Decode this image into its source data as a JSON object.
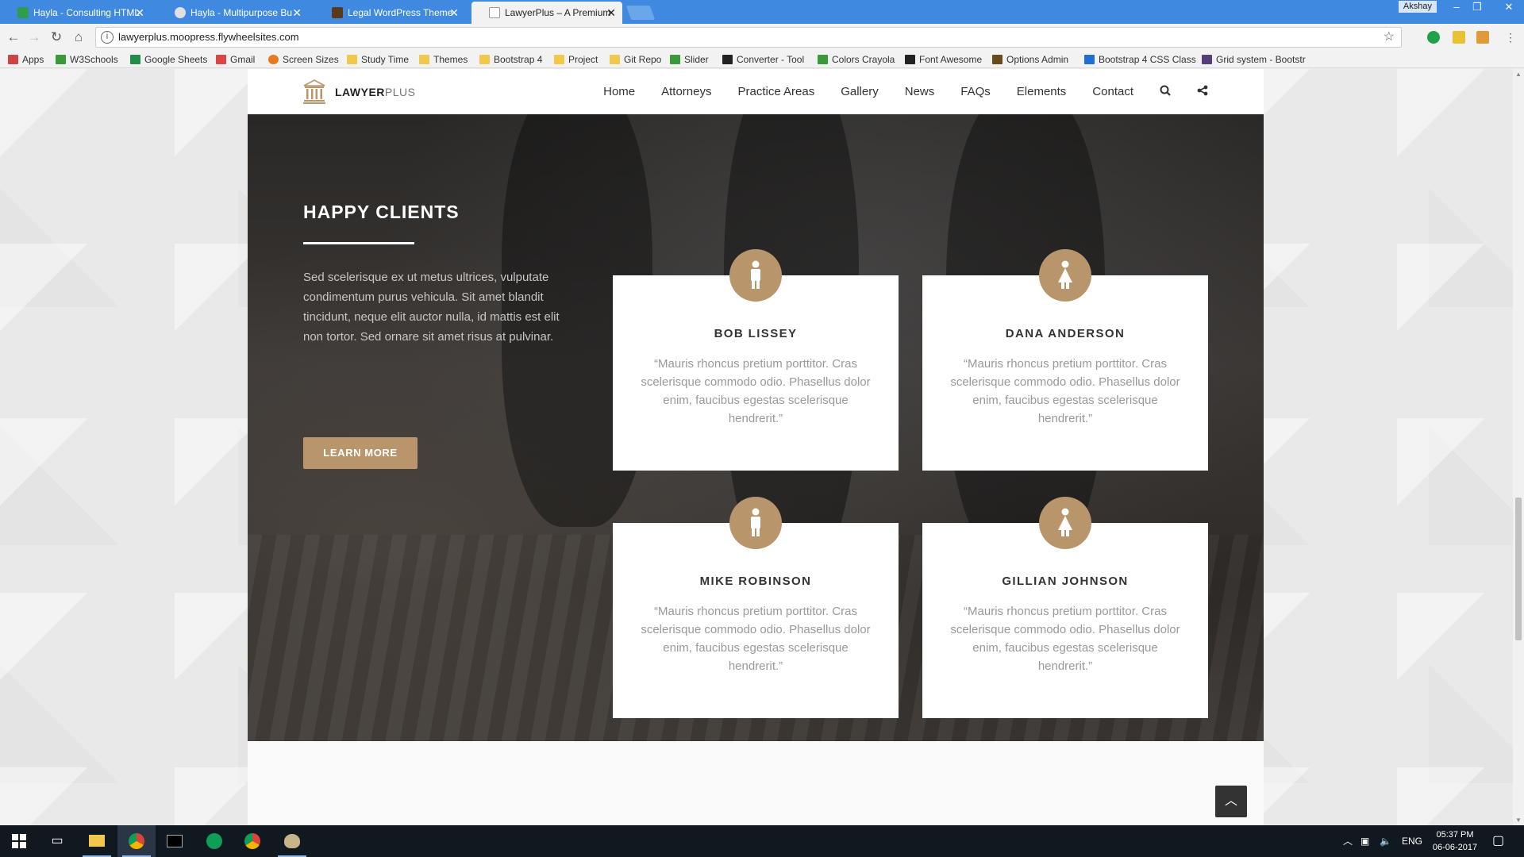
{
  "browser": {
    "tabs": [
      {
        "title": "Hayla - Consulting HTML",
        "favicon_color": "#2e9d4e"
      },
      {
        "title": "Hayla - Multipurpose Bu",
        "favicon_color": "#e0e0e0"
      },
      {
        "title": "Legal WordPress Theme",
        "favicon_color": "#5b3a1a"
      },
      {
        "title": "LawyerPlus – A Premium",
        "favicon_color": "#ffffff"
      }
    ],
    "active_tab": 3,
    "user": "Akshay",
    "url": "lawyerplus.moopress.flywheelsites.com",
    "bookmarks": [
      {
        "label": "Apps",
        "icon_color": "#c44"
      },
      {
        "label": "W3Schools",
        "icon_color": "#3a9a3a"
      },
      {
        "label": "Google Sheets",
        "icon_color": "#1f8f4a"
      },
      {
        "label": "Gmail",
        "icon_color": "#d44"
      },
      {
        "label": "Screen Sizes",
        "icon_color": "#e87a1e"
      },
      {
        "label": "Study Time",
        "icon_color": "#f1c84b"
      },
      {
        "label": "Themes",
        "icon_color": "#f1c84b"
      },
      {
        "label": "Bootstrap 4",
        "icon_color": "#f1c84b"
      },
      {
        "label": "Project",
        "icon_color": "#f1c84b"
      },
      {
        "label": "Git Repo",
        "icon_color": "#f1c84b"
      },
      {
        "label": "Slider",
        "icon_color": "#3a9a3a"
      },
      {
        "label": "Converter - Tool",
        "icon_color": "#222"
      },
      {
        "label": "Colors Crayola",
        "icon_color": "#3a9a3a"
      },
      {
        "label": "Font Awesome",
        "icon_color": "#222"
      },
      {
        "label": "Options Admin",
        "icon_color": "#6b4a1c"
      },
      {
        "label": "Bootstrap 4 CSS Class",
        "icon_color": "#1d6fd1"
      },
      {
        "label": "Grid system - Bootstr",
        "icon_color": "#563d7c"
      }
    ]
  },
  "site": {
    "logo_bold": "LAWYER",
    "logo_light": "PLUS",
    "menu": [
      "Home",
      "Attorneys",
      "Practice Areas",
      "Gallery",
      "News",
      "FAQs",
      "Elements",
      "Contact"
    ],
    "accent": "#b8956a"
  },
  "happy_clients": {
    "title": "HAPPY CLIENTS",
    "text": "Sed scelerisque ex ut metus ultrices, vulputate condimentum purus vehicula. Sit amet blandit tincidunt, neque elit auctor nulla, id mattis est elit non tortor. Sed ornare sit amet risus at pulvinar.",
    "button": "LEARN MORE",
    "testimonials": [
      {
        "name": "BOB LISSEY",
        "avatar": "male-icon",
        "quote": "“Mauris rhoncus pretium porttitor. Cras scelerisque commodo odio. Phasellus dolor enim, faucibus egestas scelerisque hendrerit.”"
      },
      {
        "name": "DANA ANDERSON",
        "avatar": "female-icon",
        "quote": "“Mauris rhoncus pretium porttitor. Cras scelerisque commodo odio. Phasellus dolor enim, faucibus egestas scelerisque hendrerit.”"
      },
      {
        "name": "MIKE ROBINSON",
        "avatar": "male-icon",
        "quote": "“Mauris rhoncus pretium porttitor. Cras scelerisque commodo odio. Phasellus dolor enim, faucibus egestas scelerisque hendrerit.”"
      },
      {
        "name": "GILLIAN JOHNSON",
        "avatar": "female-icon",
        "quote": "“Mauris rhoncus pretium porttitor. Cras scelerisque commodo odio. Phasellus dolor enim, faucibus egestas scelerisque hendrerit.”"
      }
    ]
  },
  "taskbar": {
    "language": "ENG",
    "time": "05:37 PM",
    "date": "06-06-2017"
  }
}
